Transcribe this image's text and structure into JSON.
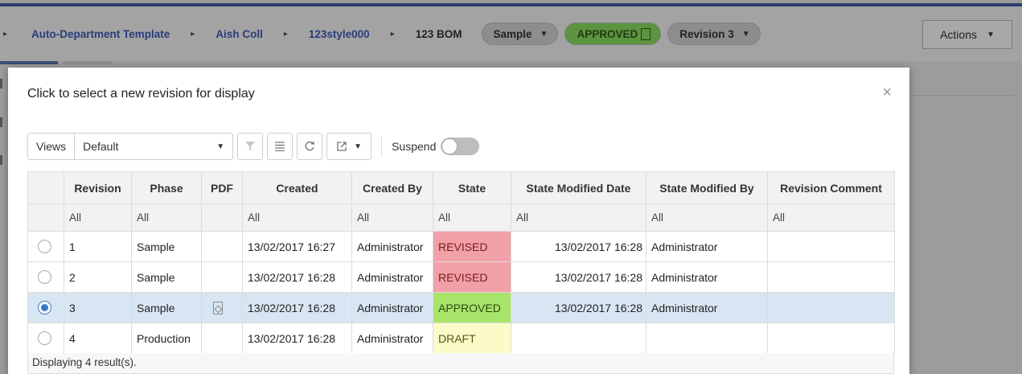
{
  "breadcrumbs": {
    "items": [
      "Auto-Department Template",
      "Aish Coll",
      "123style000"
    ],
    "current": "123 BOM",
    "separator": "▸"
  },
  "header_pills": {
    "sample": "Sample",
    "approved": "APPROVED",
    "revision": "Revision 3"
  },
  "actions_label": "Actions",
  "modal": {
    "title": "Click to select a new revision for display",
    "close_icon": "×"
  },
  "toolbar": {
    "views_label": "Views",
    "view_selected": "Default",
    "suspend_label": "Suspend",
    "suspend_on": false
  },
  "grid": {
    "columns": [
      "",
      "Revision",
      "Phase",
      "PDF",
      "Created",
      "Created By",
      "State",
      "State Modified Date",
      "State Modified By",
      "Revision Comment"
    ],
    "filter_values": [
      "",
      "All",
      "All",
      "",
      "All",
      "All",
      "All",
      "All",
      "All",
      "All"
    ],
    "rows": [
      {
        "selected": false,
        "revision": "1",
        "phase": "Sample",
        "pdf": false,
        "created": "13/02/2017 16:27",
        "created_by": "Administrator",
        "state": "REVISED",
        "state_modified_date": "13/02/2017 16:28",
        "state_modified_by": "Administrator",
        "comment": ""
      },
      {
        "selected": false,
        "revision": "2",
        "phase": "Sample",
        "pdf": false,
        "created": "13/02/2017 16:28",
        "created_by": "Administrator",
        "state": "REVISED",
        "state_modified_date": "13/02/2017 16:28",
        "state_modified_by": "Administrator",
        "comment": ""
      },
      {
        "selected": true,
        "revision": "3",
        "phase": "Sample",
        "pdf": true,
        "created": "13/02/2017 16:28",
        "created_by": "Administrator",
        "state": "APPROVED",
        "state_modified_date": "13/02/2017 16:28",
        "state_modified_by": "Administrator",
        "comment": ""
      },
      {
        "selected": false,
        "revision": "4",
        "phase": "Production",
        "pdf": false,
        "created": "13/02/2017 16:28",
        "created_by": "Administrator",
        "state": "DRAFT",
        "state_modified_date": "",
        "state_modified_by": "",
        "comment": ""
      }
    ],
    "footer": "Displaying 4 result(s)."
  },
  "colors": {
    "revised": "#f1a0a8",
    "approved": "#a9e46a",
    "draft": "#fafbc8",
    "selected_row": "#d8e6f3",
    "brand": "#2d3c6e"
  }
}
